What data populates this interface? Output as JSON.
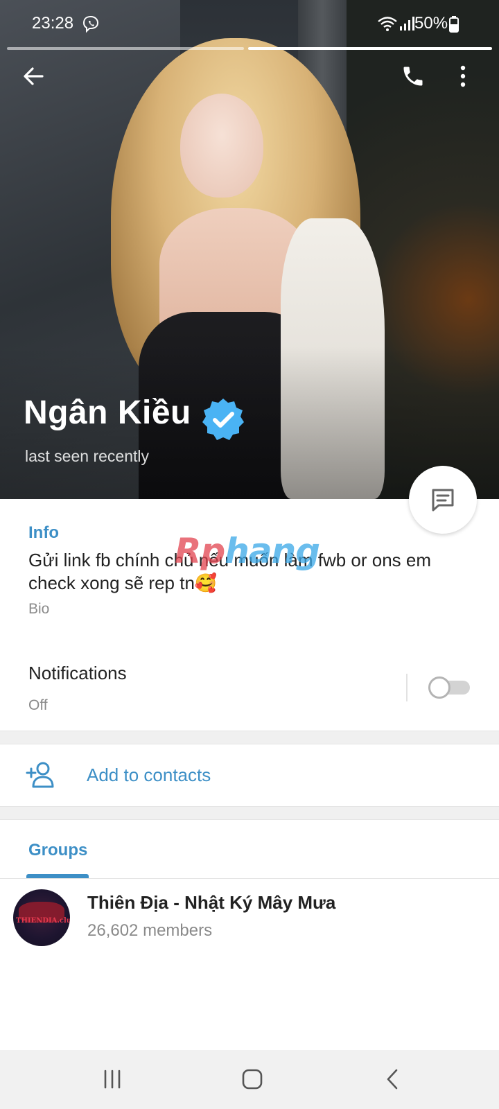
{
  "status_bar": {
    "time": "23:28",
    "battery": "50%"
  },
  "profile": {
    "name": "Ngân Kiều",
    "status": "last seen recently"
  },
  "info": {
    "section_title": "Info",
    "bio": "Gửi link fb chính chủ nếu muốn làm fwb or ons em check xong sẽ rep tn🥰",
    "bio_label": "Bio",
    "notifications_title": "Notifications",
    "notifications_value": "Off"
  },
  "actions": {
    "add_contact_label": "Add to contacts"
  },
  "groups": {
    "section_title": "Groups",
    "items": [
      {
        "name": "Thiên Địa - Nhật Ký Mây Mưa",
        "members": "26,602 members",
        "avatar_text": "THIENDIA.club"
      }
    ]
  },
  "watermark": {
    "part_a": "Rp",
    "part_b": "hang"
  },
  "icons": {
    "back": "back-arrow-icon",
    "call": "phone-icon",
    "more": "more-vertical-icon",
    "verified": "verified-badge-icon",
    "chat": "message-icon",
    "add_contact": "add-person-icon"
  },
  "colors": {
    "accent": "#3d8fc6",
    "verified": "#4ab3f4"
  }
}
